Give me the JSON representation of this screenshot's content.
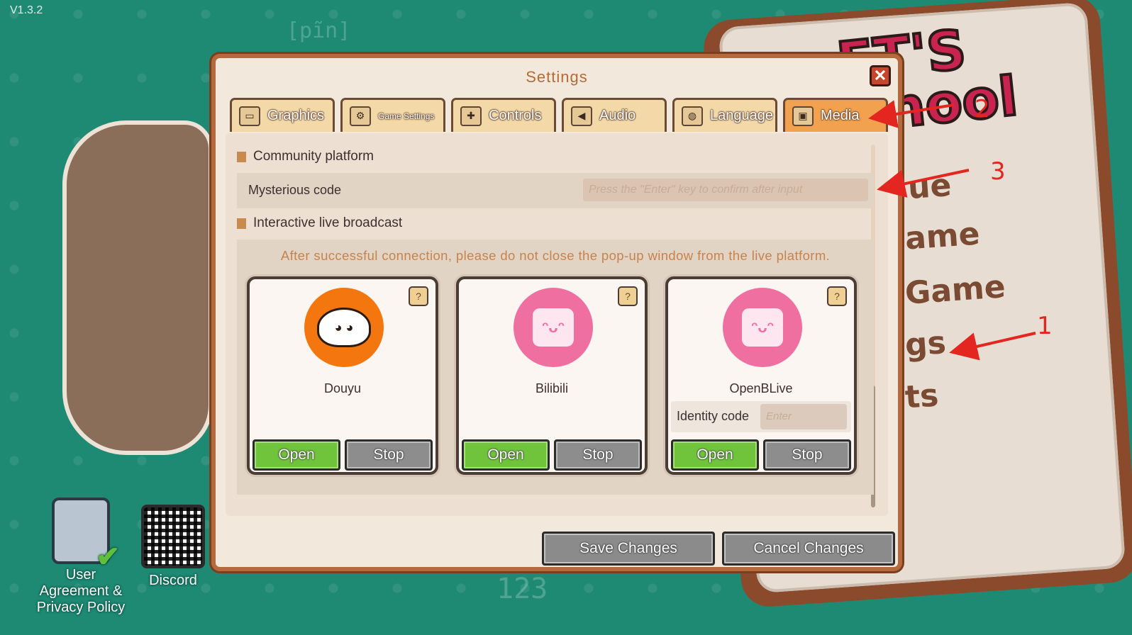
{
  "version": "V1.3.2",
  "background": {
    "deco": [
      "[pĩn]",
      "123"
    ],
    "side_buttons": [
      {
        "label": "User Agreement & Privacy Policy",
        "icon": "clipboard-check-icon"
      },
      {
        "label": "Discord",
        "icon": "qr-code-icon"
      }
    ],
    "menu_fragments": [
      "ue",
      "ame",
      "Game",
      "gs",
      "ts"
    ],
    "logo_fragments": [
      "ET'S",
      "hool"
    ]
  },
  "annotations": [
    "1",
    "2",
    "3"
  ],
  "dialog": {
    "title": "Settings",
    "close_icon": "close-icon",
    "tabs": [
      {
        "label": "Graphics",
        "icon": "monitor-icon",
        "active": false
      },
      {
        "label": "Game Settings",
        "icon": "gear-icon",
        "active": false
      },
      {
        "label": "Controls",
        "icon": "gamepad-icon",
        "active": false
      },
      {
        "label": "Audio",
        "icon": "speaker-icon",
        "active": false
      },
      {
        "label": "Language",
        "icon": "globe-icon",
        "active": false
      },
      {
        "label": "Media",
        "icon": "tv-icon",
        "active": true
      }
    ],
    "community": {
      "heading": "Community platform",
      "mysterious_code_label": "Mysterious code",
      "mysterious_code_placeholder": "Press the \"Enter\" key to confirm after input"
    },
    "live": {
      "heading": "Interactive live broadcast",
      "note": "After successful connection, please do not close the pop-up window from the live platform.",
      "platforms": [
        {
          "name": "Douyu",
          "icon": "douyu-shark-icon",
          "open": "Open",
          "stop": "Stop"
        },
        {
          "name": "Bilibili",
          "icon": "bilibili-tv-icon",
          "open": "Open",
          "stop": "Stop"
        },
        {
          "name": "OpenBLive",
          "icon": "bilibili-tv-icon",
          "open": "Open",
          "stop": "Stop",
          "identity_label": "Identity code",
          "identity_placeholder": "Enter"
        }
      ]
    },
    "footer": {
      "save": "Save Changes",
      "cancel": "Cancel Changes"
    },
    "colors": {
      "accent_tab": "#f2a24e",
      "open_button": "#6fc43c",
      "stop_button": "#8d8d8d",
      "frame": "#b56a3e"
    }
  }
}
